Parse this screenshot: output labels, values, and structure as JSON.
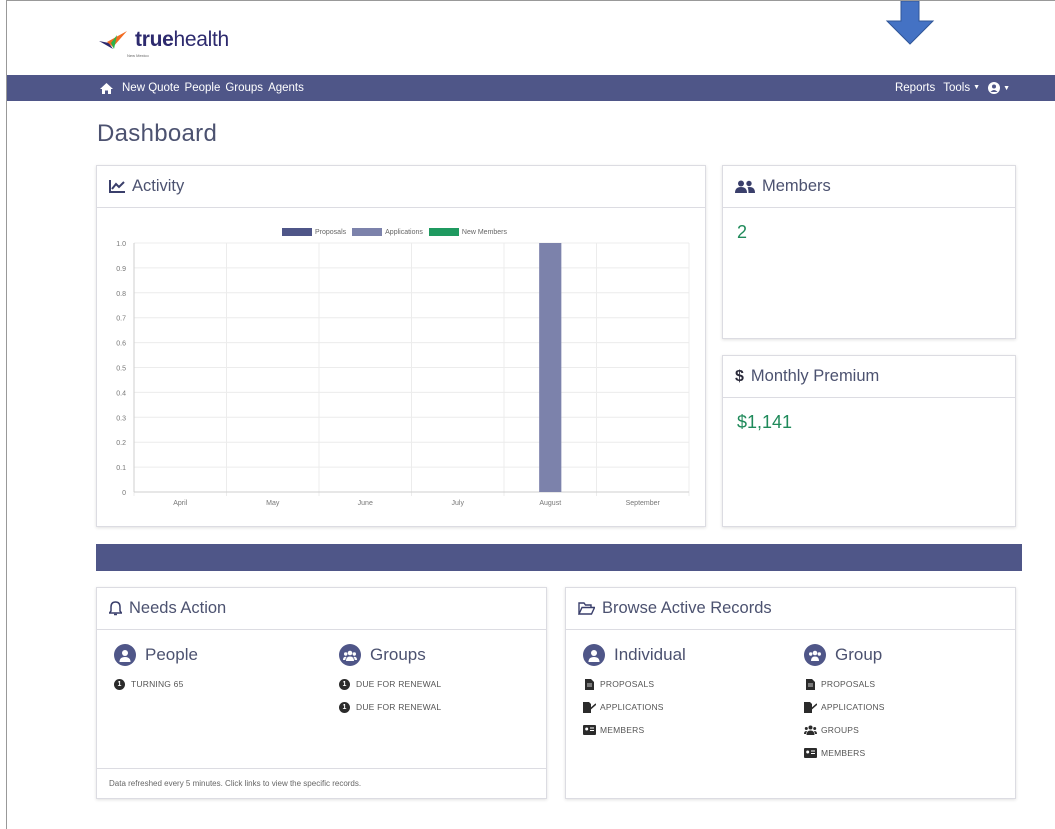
{
  "brand": {
    "true": "true",
    "health": "health",
    "subtitle": "New Mexico"
  },
  "nav": {
    "left": [
      "New Quote",
      "People",
      "Groups",
      "Agents"
    ],
    "reports": "Reports",
    "tools": "Tools"
  },
  "page": {
    "title": "Dashboard"
  },
  "activity": {
    "title": "Activity",
    "icon": "line-chart-icon"
  },
  "members": {
    "title": "Members",
    "value": "2",
    "icon": "users-icon"
  },
  "premium": {
    "title": "Monthly Premium",
    "value": "$1,141",
    "icon": "dollar-icon"
  },
  "chart_data": {
    "type": "bar",
    "categories": [
      "April",
      "May",
      "June",
      "July",
      "August",
      "September"
    ],
    "series": [
      {
        "name": "Proposals",
        "color": "#4f5688",
        "values": [
          0,
          0,
          0,
          0,
          0,
          0
        ]
      },
      {
        "name": "Applications",
        "color": "#7c82ab",
        "values": [
          0,
          0,
          0,
          0,
          1.0,
          0
        ]
      },
      {
        "name": "New Members",
        "color": "#1f9a60",
        "values": [
          0,
          0,
          0,
          0,
          0,
          0
        ]
      }
    ],
    "yticks": [
      "1.0",
      "0.9",
      "0.8",
      "0.7",
      "0.6",
      "0.5",
      "0.4",
      "0.3",
      "0.2",
      "0.1",
      "0"
    ],
    "ylim": [
      0,
      1.0
    ],
    "grid": true,
    "legend": "top"
  },
  "needs_action": {
    "title": "Needs Action",
    "people": {
      "title": "People",
      "items": [
        {
          "count": "1",
          "label": "TURNING 65"
        }
      ]
    },
    "groups": {
      "title": "Groups",
      "items": [
        {
          "count": "1",
          "label": "DUE FOR RENEWAL"
        },
        {
          "count": "1",
          "label": "DUE FOR RENEWAL"
        }
      ]
    },
    "footer": "Data refreshed every 5 minutes. Click links to view the specific records."
  },
  "browse": {
    "title": "Browse Active Records",
    "individual": {
      "title": "Individual",
      "items": [
        "PROPOSALS",
        "APPLICATIONS",
        "MEMBERS"
      ]
    },
    "group": {
      "title": "Group",
      "items": [
        "PROPOSALS",
        "APPLICATIONS",
        "GROUPS",
        "MEMBERS"
      ]
    }
  },
  "colors": {
    "nav": "#4f5688",
    "accent_green": "#1f8a5a",
    "arrow": "#4472c4"
  }
}
